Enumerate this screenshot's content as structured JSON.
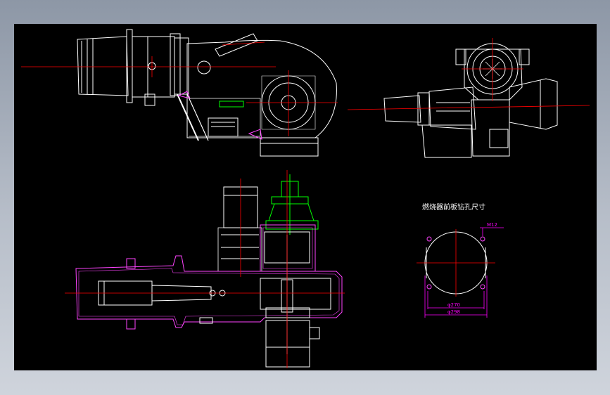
{
  "drawing": {
    "background": "#000000",
    "colors": {
      "outline": "#ffffff",
      "centerline": "#ff0000",
      "dimension": "#ff00ff",
      "accent": "#00ff00",
      "housing": "#ff44ff"
    },
    "views": [
      "front-view",
      "side-view",
      "plan-section-view",
      "mounting-hole-view"
    ],
    "mounting_hole": {
      "title": "燃烧器前板钻孔尺寸",
      "bolt_label": "M12",
      "inner_diameter_label": "φ270",
      "outer_diameter_label": "φ298"
    }
  }
}
